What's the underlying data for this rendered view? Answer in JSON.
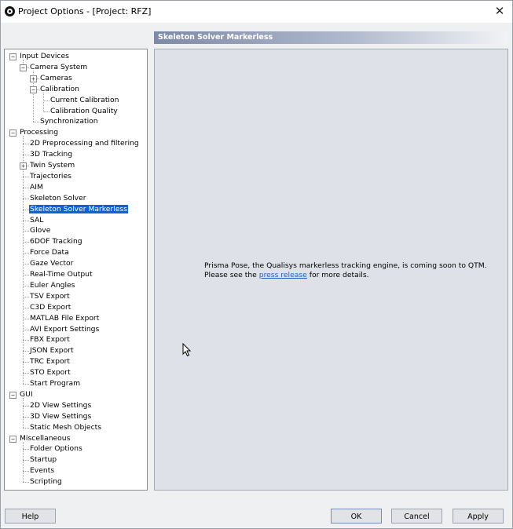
{
  "window": {
    "title": "Project Options - [Project: RFZ]"
  },
  "tree": [
    {
      "label": "Input Devices",
      "level": 0,
      "expander": "minus"
    },
    {
      "label": "Camera System",
      "level": 1,
      "expander": "minus"
    },
    {
      "label": "Cameras",
      "level": 2,
      "expander": "plus"
    },
    {
      "label": "Calibration",
      "level": 2,
      "expander": "minus"
    },
    {
      "label": "Current Calibration",
      "level": 3
    },
    {
      "label": "Calibration Quality",
      "level": 3
    },
    {
      "label": "Synchronization",
      "level": 2
    },
    {
      "label": "Processing",
      "level": 0,
      "expander": "minus"
    },
    {
      "label": "2D Preprocessing and filtering",
      "level": 1
    },
    {
      "label": "3D Tracking",
      "level": 1
    },
    {
      "label": "Twin System",
      "level": 1,
      "expander": "plus"
    },
    {
      "label": "Trajectories",
      "level": 1
    },
    {
      "label": "AIM",
      "level": 1
    },
    {
      "label": "Skeleton Solver",
      "level": 1
    },
    {
      "label": "Skeleton Solver Markerless",
      "level": 1,
      "selected": true
    },
    {
      "label": "SAL",
      "level": 1
    },
    {
      "label": "Glove",
      "level": 1
    },
    {
      "label": "6DOF Tracking",
      "level": 1
    },
    {
      "label": "Force Data",
      "level": 1
    },
    {
      "label": "Gaze Vector",
      "level": 1
    },
    {
      "label": "Real-Time Output",
      "level": 1
    },
    {
      "label": "Euler Angles",
      "level": 1
    },
    {
      "label": "TSV Export",
      "level": 1
    },
    {
      "label": "C3D Export",
      "level": 1
    },
    {
      "label": "MATLAB File Export",
      "level": 1
    },
    {
      "label": "AVI Export Settings",
      "level": 1
    },
    {
      "label": "FBX Export",
      "level": 1
    },
    {
      "label": "JSON Export",
      "level": 1
    },
    {
      "label": "TRC Export",
      "level": 1
    },
    {
      "label": "STO Export",
      "level": 1
    },
    {
      "label": "Start Program",
      "level": 1
    },
    {
      "label": "GUI",
      "level": 0,
      "expander": "minus"
    },
    {
      "label": "2D View Settings",
      "level": 1
    },
    {
      "label": "3D View Settings",
      "level": 1
    },
    {
      "label": "Static Mesh Objects",
      "level": 1
    },
    {
      "label": "Miscellaneous",
      "level": 0,
      "expander": "minus"
    },
    {
      "label": "Folder Options",
      "level": 1
    },
    {
      "label": "Startup",
      "level": 1
    },
    {
      "label": "Events",
      "level": 1
    },
    {
      "label": "Scripting",
      "level": 1
    }
  ],
  "panel": {
    "header": "Skeleton Solver Markerless",
    "message_line1": "Prisma Pose, the Qualisys markerless tracking engine, is coming soon to QTM.",
    "message_line2_prefix": "Please see the ",
    "message_link": "press release",
    "message_line2_suffix": " for more details."
  },
  "buttons": {
    "help": "Help",
    "ok": "OK",
    "cancel": "Cancel",
    "apply": "Apply"
  },
  "icons": {
    "close": "close-icon",
    "app": "qualisys-app-icon",
    "cursor": "mouse-pointer-icon"
  },
  "colors": {
    "selection": "#0a64d8",
    "header_start": "#7d8aa6",
    "link": "#1f5fbf"
  }
}
